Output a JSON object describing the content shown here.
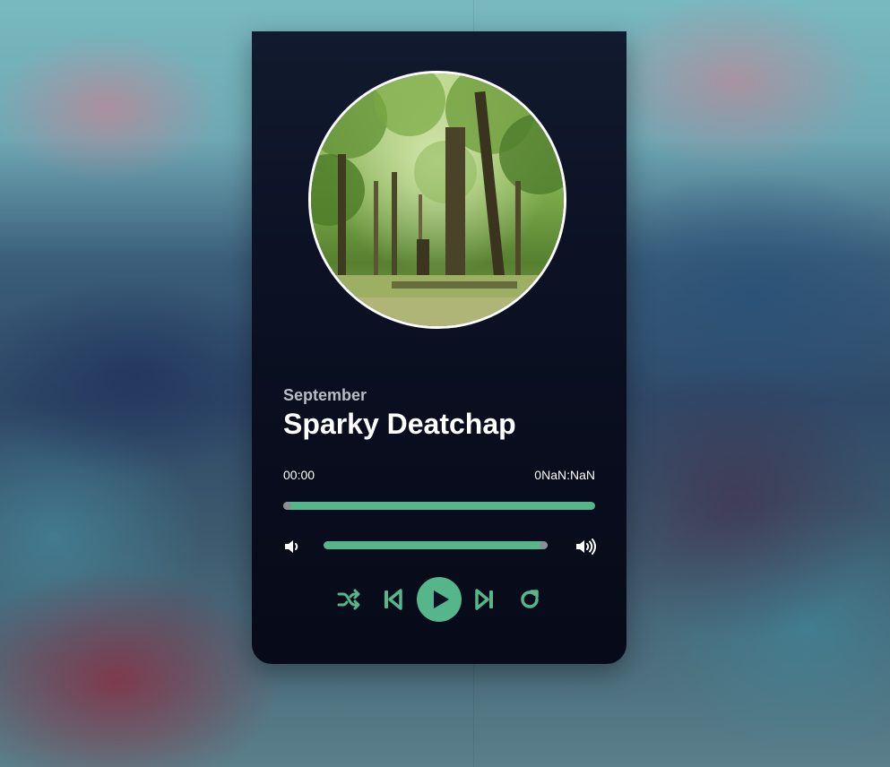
{
  "player": {
    "artist": "September",
    "title": "Sparky Deatchap",
    "current_time": "00:00",
    "total_time": "0NaN:NaN",
    "progress": 0,
    "volume": 1,
    "accent_color": "#55b58b",
    "cover_image": "forest"
  },
  "icons": {
    "volume_down": "volume-down-icon",
    "volume_up": "volume-up-icon",
    "shuffle": "shuffle-icon",
    "previous": "skip-previous-icon",
    "play": "play-icon",
    "next": "skip-next-icon",
    "repeat": "repeat-icon"
  }
}
